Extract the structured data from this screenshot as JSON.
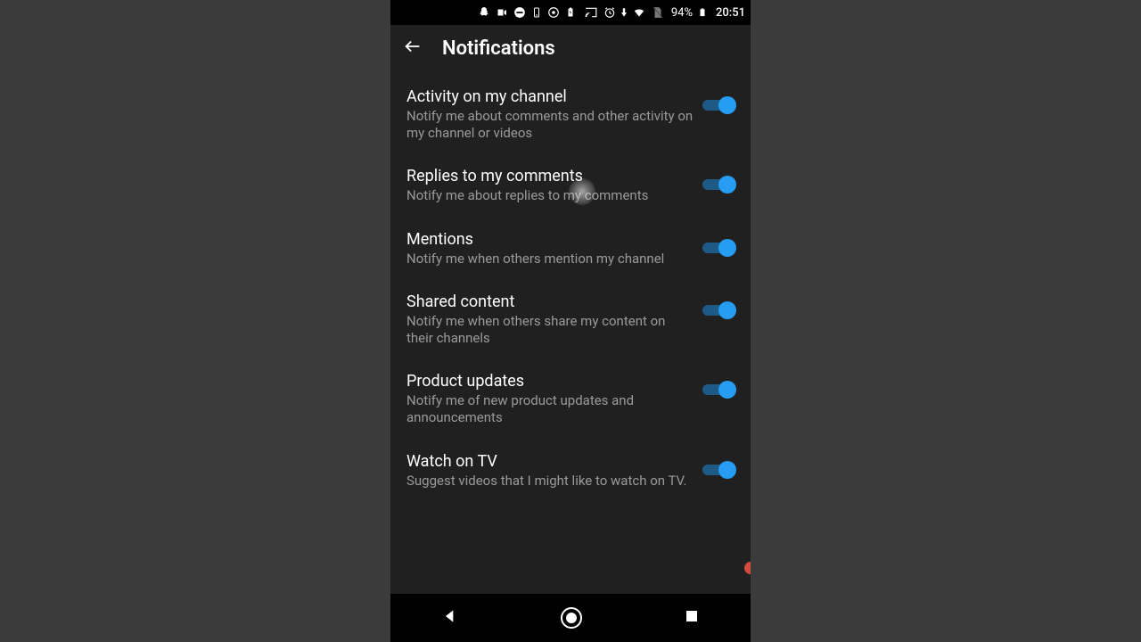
{
  "statusbar": {
    "battery_percent": "94%",
    "clock": "20:51"
  },
  "header": {
    "title": "Notifications"
  },
  "settings": [
    {
      "title": "Activity on my channel",
      "desc": "Notify me about comments and other activity on my channel or videos",
      "on": true
    },
    {
      "title": "Replies to my comments",
      "desc": "Notify me about replies to my comments",
      "on": true
    },
    {
      "title": "Mentions",
      "desc": "Notify me when others mention my channel",
      "on": true
    },
    {
      "title": "Shared content",
      "desc": "Notify me when others share my content on their channels",
      "on": true
    },
    {
      "title": "Product updates",
      "desc": "Notify me of new product updates and announcements",
      "on": true
    },
    {
      "title": "Watch on TV",
      "desc": "Suggest videos that I might like to watch on TV.",
      "on": true
    }
  ]
}
